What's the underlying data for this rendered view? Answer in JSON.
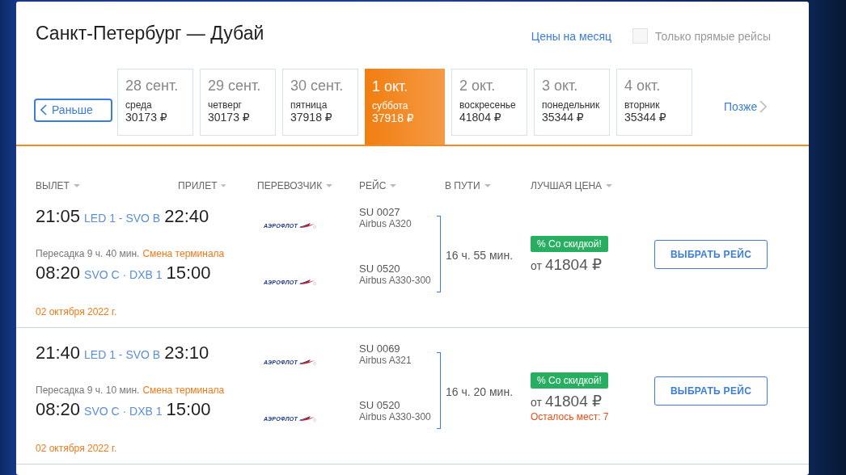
{
  "title": "Санкт-Петербург — Дубай",
  "month_prices_link": "Цены на месяц",
  "direct_only": {
    "label": "Только прямые рейсы",
    "checked": false
  },
  "earlier_button": "Раньше",
  "later_link": "Позже",
  "dates": [
    {
      "date": "28 сент.",
      "weekday": "среда",
      "price": "30173 ₽",
      "selected": false
    },
    {
      "date": "29 сент.",
      "weekday": "четверг",
      "price": "30173 ₽",
      "selected": false
    },
    {
      "date": "30 сент.",
      "weekday": "пятница",
      "price": "37918 ₽",
      "selected": false
    },
    {
      "date": "1 окт.",
      "weekday": "суббота",
      "price": "37918 ₽",
      "selected": true
    },
    {
      "date": "2 окт.",
      "weekday": "воскресенье",
      "price": "41804 ₽",
      "selected": false
    },
    {
      "date": "3 окт.",
      "weekday": "понедельник",
      "price": "35344 ₽",
      "selected": false
    },
    {
      "date": "4 окт.",
      "weekday": "вторник",
      "price": "35344 ₽",
      "selected": false
    }
  ],
  "columns": [
    "ВЫЛЕТ",
    "ПРИЛЕТ",
    "ПЕРЕВОЗЧИК",
    "РЕЙС",
    "В ПУТИ",
    "ЛУЧШАЯ ЦЕНА"
  ],
  "flights": [
    {
      "segments": [
        {
          "departure": "21:05",
          "route": "LED 1 - SVO B",
          "arrival": "22:40",
          "carrier": "АЭРОФЛОТ",
          "flight": "SU 0027",
          "aircraft": "Airbus A320"
        },
        {
          "departure": "08:20",
          "route": "SVO C · DXB 1",
          "arrival": "15:00",
          "carrier": "АЭРОФЛОТ",
          "flight": "SU 0520",
          "aircraft": "Airbus A330-300"
        }
      ],
      "transfer": "Пересадка 9 ч. 40 мин.",
      "transfer_note": "Смена терминала",
      "arrival_date": "02 октября 2022 г.",
      "duration": "16 ч. 55 мин.",
      "badge": "% Со скидкой!",
      "price_prefix": "от",
      "price": "41804 ₽",
      "button": "ВЫБРАТЬ РЕЙС"
    },
    {
      "segments": [
        {
          "departure": "21:40",
          "route": "LED 1 - SVO B",
          "arrival": "23:10",
          "carrier": "АЭРОФЛОТ",
          "flight": "SU 0069",
          "aircraft": "Airbus A321"
        },
        {
          "departure": "08:20",
          "route": "SVO C · DXB 1",
          "arrival": "15:00",
          "carrier": "АЭРОФЛОТ",
          "flight": "SU 0520",
          "aircraft": "Airbus A330-300"
        }
      ],
      "transfer": "Пересадка 9 ч. 10 мин.",
      "transfer_note": "Смена терминала",
      "arrival_date": "02 октября 2022 г.",
      "duration": "16 ч. 20 мин.",
      "badge": "% Со скидкой!",
      "price_prefix": "от",
      "price": "41804 ₽",
      "seats_left": "Осталось мест: 7",
      "button": "ВЫБРАТЬ РЕЙС"
    }
  ]
}
